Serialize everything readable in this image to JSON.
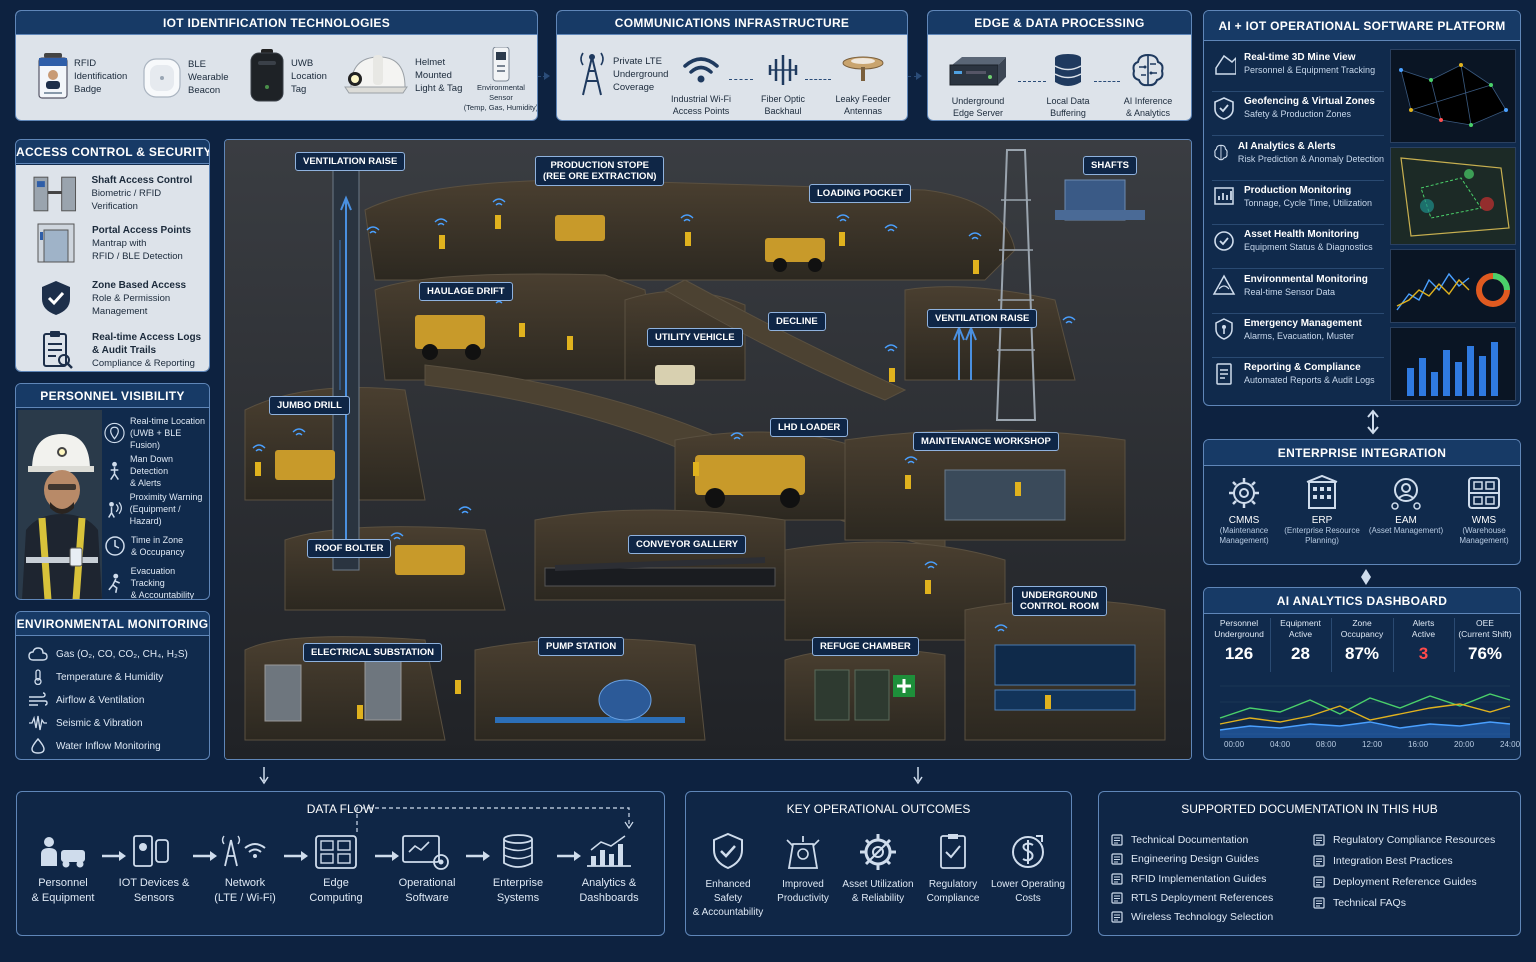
{
  "iot": {
    "title": "IOT IDENTIFICATION TECHNOLOGIES",
    "items": [
      {
        "label": "RFID\nIdentification\nBadge"
      },
      {
        "label": "BLE\nWearable\nBeacon"
      },
      {
        "label": "UWB\nLocation\nTag"
      },
      {
        "label": "Helmet\nMounted\nLight & Tag"
      },
      {
        "label": "Environmental\nSensor\n(Temp, Gas, Humidity)"
      }
    ]
  },
  "comms": {
    "title": "COMMUNICATIONS INFRASTRUCTURE",
    "items": [
      {
        "label": "Private LTE\nUnderground\nCoverage"
      },
      {
        "label": "Industrial Wi-Fi\nAccess Points"
      },
      {
        "label": "Fiber Optic\nBackhaul"
      },
      {
        "label": "Leaky Feeder\nAntennas"
      }
    ]
  },
  "edge": {
    "title": "EDGE & DATA PROCESSING",
    "items": [
      {
        "label": "Underground\nEdge Server"
      },
      {
        "label": "Local Data\nBuffering"
      },
      {
        "label": "AI Inference\n& Analytics"
      }
    ]
  },
  "access": {
    "title": "ACCESS CONTROL & SECURITY",
    "items": [
      {
        "title": "Shaft Access Control",
        "sub": "Biometric / RFID Verification"
      },
      {
        "title": "Portal Access Points",
        "sub": "Mantrap with\nRFID / BLE Detection"
      },
      {
        "title": "Zone Based Access",
        "sub": "Role & Permission\nManagement"
      },
      {
        "title": "Real-time Access Logs\n& Audit Trails",
        "sub": "Compliance & Reporting"
      }
    ]
  },
  "personnel": {
    "title": "PERSONNEL VISIBILITY",
    "items": [
      {
        "label": "Real-time Location\n(UWB + BLE Fusion)"
      },
      {
        "label": "Man Down Detection\n& Alerts"
      },
      {
        "label": "Proximity Warning\n(Equipment / Hazard)"
      },
      {
        "label": "Time in Zone\n& Occupancy"
      },
      {
        "label": "Evacuation Tracking\n& Accountability"
      }
    ]
  },
  "env": {
    "title": "ENVIRONMENTAL MONITORING",
    "items": [
      {
        "label": "Gas (O₂, CO, CO₂, CH₄, H₂S)"
      },
      {
        "label": "Temperature & Humidity"
      },
      {
        "label": "Airflow & Ventilation"
      },
      {
        "label": "Seismic & Vibration"
      },
      {
        "label": "Water Inflow Monitoring"
      }
    ]
  },
  "mine": {
    "labels": {
      "vent1": "VENTILATION RAISE",
      "stope": "PRODUCTION STOPE\n(REE ORE EXTRACTION)",
      "loading": "LOADING POCKET",
      "shafts": "SHAFTS",
      "haulage": "HAULAGE DRIFT",
      "utility": "UTILITY VEHICLE",
      "decline": "DECLINE",
      "vent2": "VENTILATION RAISE",
      "jumbo": "JUMBO DRILL",
      "lhd": "LHD LOADER",
      "workshop": "MAINTENANCE WORKSHOP",
      "bolter": "ROOF BOLTER",
      "conveyor": "CONVEYOR GALLERY",
      "control": "UNDERGROUND\nCONTROL ROOM",
      "substation": "ELECTRICAL SUBSTATION",
      "pump": "PUMP STATION",
      "refuge": "REFUGE CHAMBER"
    }
  },
  "platform": {
    "title": "AI + IOT OPERATIONAL SOFTWARE PLATFORM",
    "items": [
      {
        "title": "Real-time 3D Mine View",
        "sub": "Personnel & Equipment Tracking"
      },
      {
        "title": "Geofencing & Virtual Zones",
        "sub": "Safety & Production Zones"
      },
      {
        "title": "AI Analytics & Alerts",
        "sub": "Risk Prediction & Anomaly Detection"
      },
      {
        "title": "Production Monitoring",
        "sub": "Tonnage, Cycle Time, Utilization"
      },
      {
        "title": "Asset Health Monitoring",
        "sub": "Equipment Status & Diagnostics"
      },
      {
        "title": "Environmental Monitoring",
        "sub": "Real-time Sensor Data"
      },
      {
        "title": "Emergency Management",
        "sub": "Alarms, Evacuation, Muster"
      },
      {
        "title": "Reporting & Compliance",
        "sub": "Automated Reports & Audit Logs"
      }
    ]
  },
  "enterprise": {
    "title": "ENTERPRISE INTEGRATION",
    "items": [
      {
        "title": "CMMS",
        "sub": "(Maintenance\nManagement)"
      },
      {
        "title": "ERP",
        "sub": "(Enterprise Resource\nPlanning)"
      },
      {
        "title": "EAM",
        "sub": "(Asset Management)"
      },
      {
        "title": "WMS",
        "sub": "(Warehouse\nManagement)"
      }
    ]
  },
  "dashboard": {
    "title": "AI ANALYTICS DASHBOARD",
    "kpis": [
      {
        "label": "Personnel\nUnderground",
        "value": "126",
        "color": "#ffffff"
      },
      {
        "label": "Equipment\nActive",
        "value": "28",
        "color": "#ffffff"
      },
      {
        "label": "Zone\nOccupancy",
        "value": "87%",
        "color": "#ffffff"
      },
      {
        "label": "Alerts\nActive",
        "value": "3",
        "color": "#ff4a4a"
      },
      {
        "label": "OEE\n(Current Shift)",
        "value": "76%",
        "color": "#ffffff"
      }
    ],
    "xticks": [
      "00:00",
      "04:00",
      "08:00",
      "12:00",
      "16:00",
      "20:00",
      "24:00"
    ]
  },
  "dataflow": {
    "title": "DATA FLOW",
    "items": [
      {
        "label": "Personnel\n& Equipment"
      },
      {
        "label": "IOT Devices &\nSensors"
      },
      {
        "label": "Network\n(LTE / Wi-Fi)"
      },
      {
        "label": "Edge\nComputing"
      },
      {
        "label": "Operational\nSoftware"
      },
      {
        "label": "Enterprise\nSystems"
      },
      {
        "label": "Analytics &\nDashboards"
      }
    ]
  },
  "outcomes": {
    "title": "KEY OPERATIONAL OUTCOMES",
    "items": [
      {
        "label": "Enhanced Safety\n& Accountability"
      },
      {
        "label": "Improved\nProductivity"
      },
      {
        "label": "Asset Utilization\n& Reliability"
      },
      {
        "label": "Regulatory\nCompliance"
      },
      {
        "label": "Lower Operating\nCosts"
      }
    ]
  },
  "docs": {
    "title": "SUPPORTED DOCUMENTATION IN THIS HUB",
    "left": [
      "Technical Documentation",
      "Engineering Design Guides",
      "RFID Implementation Guides",
      "RTLS Deployment References",
      "Wireless Technology Selection"
    ],
    "right": [
      "Regulatory Compliance Resources",
      "Integration Best Practices",
      "Deployment Reference Guides",
      "Technical FAQs"
    ]
  },
  "colors": {
    "background": "#0d2240",
    "panel": "#102a4c",
    "border": "#5f86b8",
    "accent": "#8fb2de",
    "alert": "#ff4a4a",
    "safety_yellow": "#e0b21e"
  }
}
